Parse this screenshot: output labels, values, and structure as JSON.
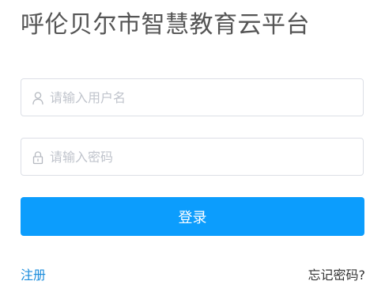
{
  "header": {
    "title": "呼伦贝尔市智慧教育云平台"
  },
  "login_form": {
    "username": {
      "value": "",
      "placeholder": "请输入用户名",
      "icon": "user-icon"
    },
    "password": {
      "value": "",
      "placeholder": "请输入密码",
      "icon": "lock-icon"
    },
    "submit_label": "登录"
  },
  "links": {
    "register_label": "注册",
    "forgot_label": "忘记密码?"
  },
  "colors": {
    "title_text": "#555555",
    "primary_button": "#0c9dfd",
    "register_link": "#1a8cdc",
    "input_border": "#dcdfe6",
    "placeholder": "#c0c4cc"
  }
}
